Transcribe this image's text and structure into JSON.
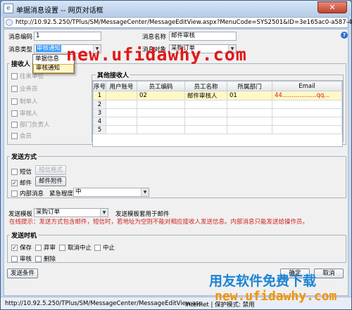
{
  "window": {
    "title": "单据消息设置 -- 网页对话框",
    "close_label": "✕",
    "url": "http://10.92.5.250/TPlus/SM/MessageCenter/MessageEditView.aspx?MenuCode=SYS2501&ID=3e165ac0-a587-4b4a-a"
  },
  "form": {
    "code_label": "消息编码",
    "code_value": "1",
    "name_label": "消息名称",
    "name_value": "邮件审核",
    "type_label": "消息类型",
    "type_value": "审核通知",
    "object_label": "消息对象",
    "object_value": "采购订单"
  },
  "type_dropdown": {
    "options": [
      "单据信息",
      "审核通知"
    ],
    "highlighted": "审核通知"
  },
  "receivers": {
    "section_title": "接收人",
    "options": [
      {
        "label": "往来单位",
        "checked": false
      },
      {
        "label": "业务员",
        "checked": false
      },
      {
        "label": "制单人",
        "checked": false
      },
      {
        "label": "审核人",
        "checked": false
      },
      {
        "label": "部门负责人",
        "checked": false
      },
      {
        "label": "会员",
        "checked": false
      }
    ],
    "other_title": "其他接收人",
    "columns": [
      "序号",
      "用户账号",
      "员工编码",
      "员工名称",
      "所属部门",
      "Email"
    ],
    "rows": [
      {
        "no": "1",
        "account": "",
        "emp_code": "02",
        "emp_name": "邮件审核人",
        "dept": "01",
        "email": "44..................qq..."
      }
    ],
    "empty_row_numbers": [
      "2",
      "3",
      "4",
      "5"
    ]
  },
  "send_method": {
    "section_title": "发送方式",
    "sms_label": "短信",
    "sms_checked": false,
    "sms_button": "短信格式",
    "email_label": "邮件",
    "email_checked": true,
    "email_button": "邮件附件",
    "internal_label": "内部消息",
    "internal_checked": false,
    "urgency_label": "紧急程度",
    "urgency_value": "中"
  },
  "template": {
    "label": "发送模板",
    "value": "采购订单",
    "note": "发送模板套用于邮件"
  },
  "hint": "在线提示：发送方式包含邮件，短信时，若地址为空则不能对相应接收人发送信息。内部消息只能发送给操作员。",
  "send_time": {
    "section_title": "发送时机",
    "options": [
      {
        "label": "保存",
        "checked": true
      },
      {
        "label": "弃审",
        "checked": false
      },
      {
        "label": "取消中止",
        "checked": false
      },
      {
        "label": "中止",
        "checked": false
      },
      {
        "label": "审核",
        "checked": false
      },
      {
        "label": "删除",
        "checked": false
      }
    ]
  },
  "buttons": {
    "conditions": "发送条件",
    "ok": "确定",
    "cancel": "取消"
  },
  "statusbar": {
    "url": "http://10.92.5.250/TPlus/SM/MessageCenter/MessageEditView.asp",
    "zone": "Internet | 保护模式: 禁用"
  },
  "watermarks": {
    "top": "new.ufidawhy.com",
    "brand": "用友软件免费下载",
    "url": "new.ufidawhy.com"
  },
  "colors": {
    "hint": "#d0201c",
    "selected_row": "#fff8c6",
    "watermark_red": "#e01818",
    "watermark_blue": "#1a84d6",
    "watermark_orange": "#f39200"
  }
}
